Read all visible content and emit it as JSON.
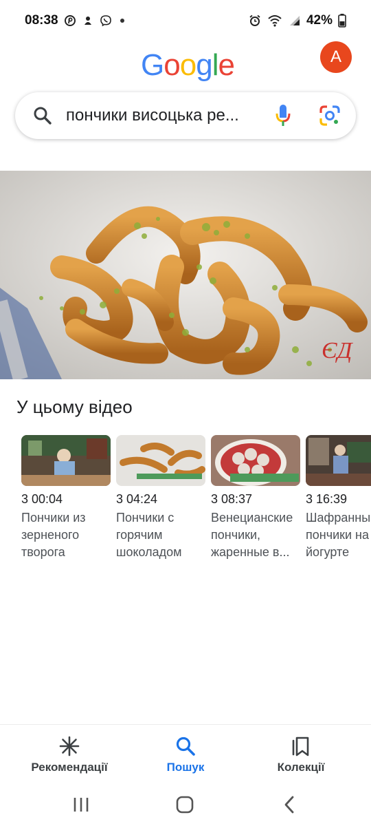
{
  "status_bar": {
    "time": "08:38",
    "battery": "42%",
    "left_icons": [
      "pinterest-icon",
      "notification-icon",
      "viber-icon",
      "more-dot"
    ],
    "right_icons": [
      "alarm-icon",
      "wifi-icon",
      "signal-icon",
      "battery-icon"
    ]
  },
  "header": {
    "logo_letters": [
      "G",
      "o",
      "o",
      "g",
      "l",
      "e"
    ],
    "logo_colors": [
      "#4285F4",
      "#EA4335",
      "#FBBC05",
      "#4285F4",
      "#34A853",
      "#EA4335"
    ],
    "avatar_letter": "A",
    "avatar_color": "#e8471d"
  },
  "search": {
    "query": "пончики висоцька ре..."
  },
  "hero": {
    "watermark": "ЄД"
  },
  "video_section": {
    "title": "У цьому відео",
    "moments": [
      {
        "time": "3 00:04",
        "title_lines": [
          "Пончики из",
          "зерненого",
          "творога"
        ]
      },
      {
        "time": "3 04:24",
        "title_lines": [
          "Пончики с",
          "горячим",
          "шоколадом"
        ]
      },
      {
        "time": "3 08:37",
        "title_lines": [
          "Венецианские",
          "пончики,",
          "жаренные в..."
        ]
      },
      {
        "time": "3 16:39",
        "title_lines": [
          "Шафранные",
          "пончики на",
          "йогурте"
        ]
      }
    ]
  },
  "bottom_nav": {
    "items": [
      {
        "label": "Рекомендації",
        "icon": "asterisk-icon"
      },
      {
        "label": "Пошук",
        "icon": "search-icon",
        "active": true
      },
      {
        "label": "Колекції",
        "icon": "collections-icon"
      }
    ],
    "active_color": "#1a73e8"
  }
}
